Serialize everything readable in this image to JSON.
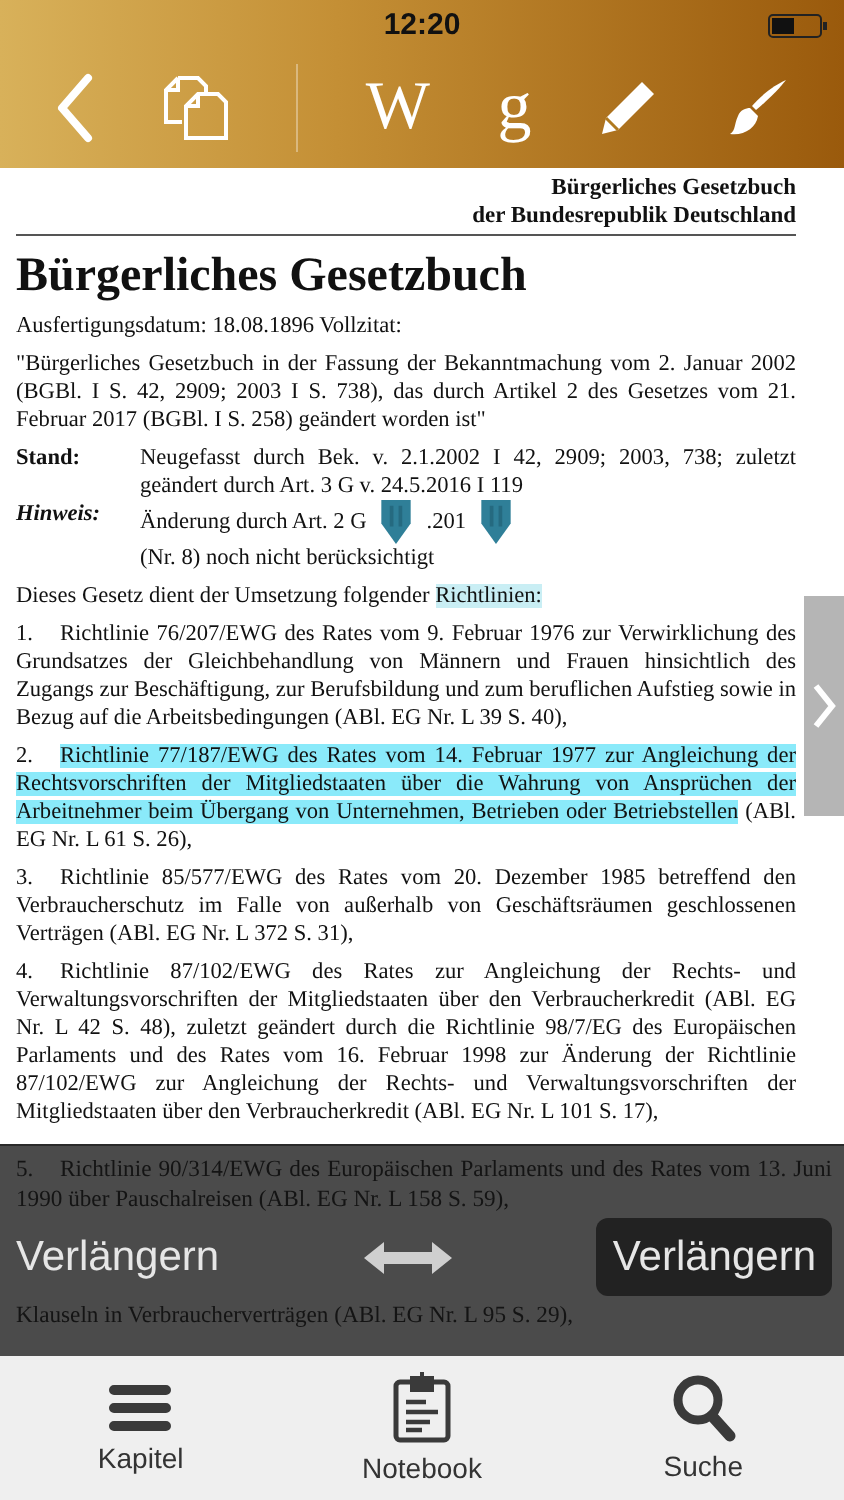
{
  "status_bar": {
    "time": "12:20"
  },
  "toolbar": {
    "items": [
      {
        "kind": "back"
      },
      {
        "kind": "copy"
      },
      {
        "kind": "text",
        "label": "W"
      },
      {
        "kind": "text",
        "label": "g"
      },
      {
        "kind": "pencil"
      },
      {
        "kind": "brush"
      }
    ]
  },
  "document": {
    "header": [
      "Bürgerliches Gesetzbuch",
      "der Bundesrepublik Deutschland"
    ],
    "title": "Bürgerliches Gesetzbuch",
    "date_line": "Ausfertigungsdatum:  18.08.1896 Vollzitat:",
    "citation": "\"Bürgerliches Gesetzbuch in der Fassung der Bekanntmachung vom 2. Januar 2002 (BGBl. I S. 42, 2909; 2003 I S. 738), das durch Artikel 2 des Gesetzes vom 21. Februar 2017 (BGBl. I S. 258) geändert worden ist\"",
    "notes": [
      {
        "kind": "stand",
        "label": "Stand:",
        "segments": [
          "Neugefasst durch Bek. v. 2.1.2002 I 42, 2909; 2003, 738; zuletzt geändert durch Art. 3 G v. 24.5.2016 I 119"
        ]
      },
      {
        "kind": "hinweis",
        "label": "Hinweis:",
        "segments": [
          "Änderung durch Art. 2 G",
          ".201",
          "(Nr. 8) noch nicht berücksichtigt"
        ]
      }
    ],
    "intro": [
      {
        "text": "Dieses Gesetz dient der Umsetzung folgender ",
        "highlighted": false
      },
      {
        "text": "Richtlinien:",
        "highlighted": true
      }
    ],
    "items": [
      {
        "number": "1.",
        "segments": [
          {
            "text": "Richtlinie 76/207/EWG des Rates vom 9. Februar 1976 zur Verwirklichung des Grundsatzes der Gleichbehandlung von Männern und Frauen hinsichtlich des Zugangs zur Beschäftigung, zur Berufsbildung und zum beruflichen Aufstieg sowie in Bezug auf die Arbeitsbedingungen (ABl. EG Nr. L 39 S. 40),",
            "highlighted": false
          }
        ]
      },
      {
        "number": "2.",
        "segments": [
          {
            "text": "Richtlinie 77/187/EWG des Rates vom 14. Februar 1977 zur Angleichung der Rechtsvorschriften der Mitgliedstaaten über die Wahrung von Ansprüchen der Arbeitnehmer beim Übergang von Unternehmen, Betrieben oder Betriebstellen",
            "highlighted": true
          },
          {
            "text": " (ABl. EG Nr. L 61 S. 26),",
            "highlighted": false
          }
        ]
      },
      {
        "number": "3.",
        "segments": [
          {
            "text": "Richtlinie 85/577/EWG des Rates vom 20. Dezember 1985 betreffend den Verbraucherschutz im Falle von außerhalb von Geschäftsräumen geschlossenen Verträgen (ABl. EG Nr. L 372 S. 31),",
            "highlighted": false
          }
        ]
      },
      {
        "number": "4.",
        "segments": [
          {
            "text": "Richtlinie 87/102/EWG des Rates zur Angleichung der Rechts- und Verwaltungsvorschriften der Mitgliedstaaten über den Verbraucherkredit (ABl. EG Nr. L 42 S. 48), zuletzt geändert durch die Richtlinie 98/7/EG des Europäischen Parlaments und des Rates vom 16. Februar 1998 zur Änderung der Richtlinie 87/102/EWG zur Angleichung der Rechts- und Verwaltungsvorschriften der Mitgliedstaaten über den Verbraucherkredit (ABl. EG Nr. L 101 S. 17),",
            "highlighted": false
          }
        ]
      }
    ]
  },
  "overlay": {
    "item": {
      "number": "5.",
      "text": "Richtlinie 90/314/EWG des Europäischen Parlaments und des Rates vom 13. Juni 1990 über Pauschalreisen (ABl. EG Nr. L 158 S. 59),"
    },
    "left_label": "Verlängern",
    "right_label": "Verlängern",
    "tail": "Klauseln in Verbraucherverträgen (ABl. EG Nr. L 95 S. 29),"
  },
  "tab_bar": [
    {
      "kind": "menu",
      "label": "Kapitel"
    },
    {
      "kind": "clipboard",
      "label": "Notebook"
    },
    {
      "kind": "search",
      "label": "Suche"
    }
  ]
}
